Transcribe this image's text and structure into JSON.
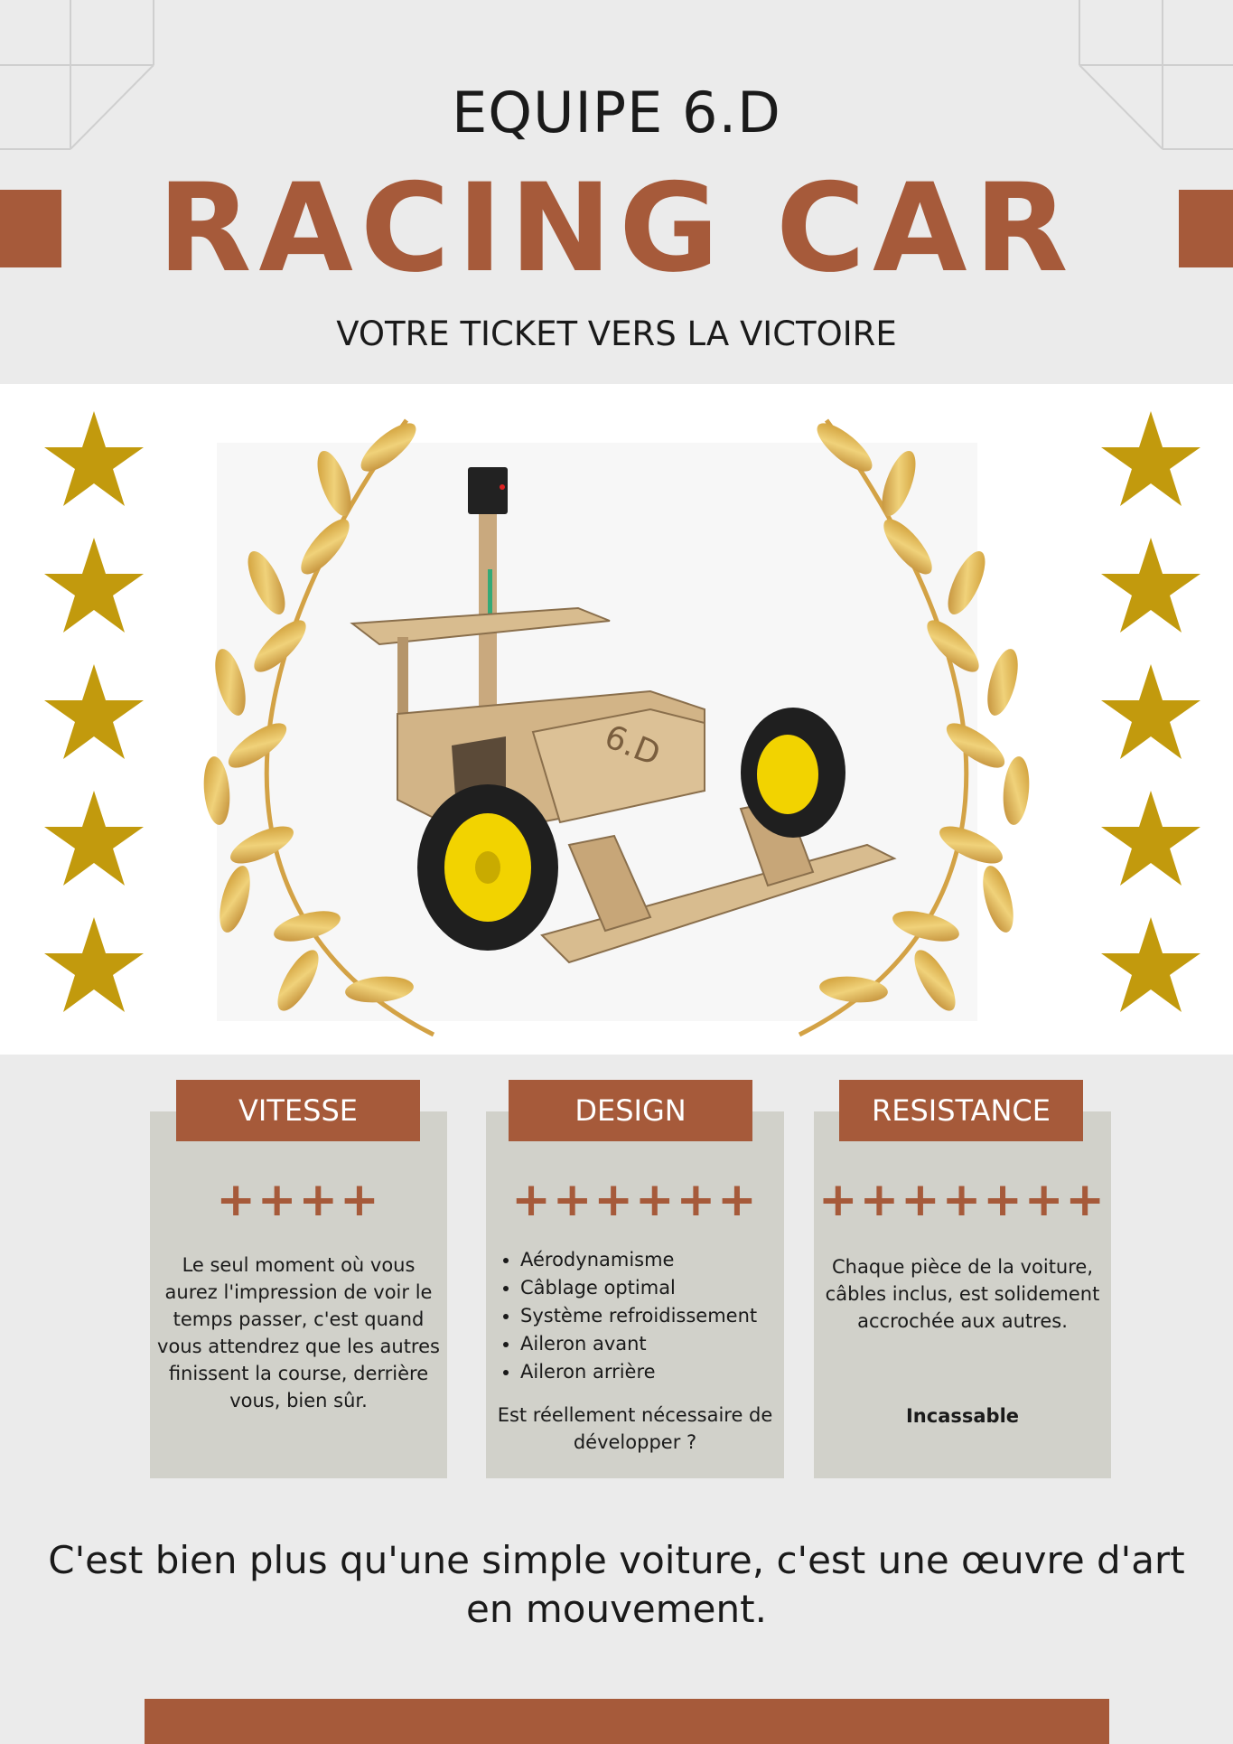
{
  "header": {
    "team": "EQUIPE 6.D",
    "title": "RACING CAR",
    "subtitle": "VOTRE TICKET VERS LA VICTOIRE"
  },
  "colors": {
    "accent": "#a65a3a",
    "star": "#c29a0d",
    "card": "#d1d1ca",
    "background": "#ebebeb"
  },
  "hero": {
    "car_label": "6.D",
    "stars_per_side": 5
  },
  "cards": [
    {
      "title": "VITESSE",
      "rating": "++++",
      "text": "Le seul moment où vous aurez l'impression de voir le temps passer, c'est quand vous attendrez que les autres finissent la course, derrière vous, bien sûr."
    },
    {
      "title": "DESIGN",
      "rating": "++++++",
      "items": [
        "Aérodynamisme",
        "Câblage optimal",
        "Système refroidissement",
        "Aileron avant",
        "Aileron arrière"
      ],
      "text": "Est réellement nécessaire de développer ?"
    },
    {
      "title": "RESISTANCE",
      "rating": "+++++++",
      "text": "Chaque pièce de la voiture, câbles inclus, est solidement accrochée aux autres.",
      "emphasis": "Incassable"
    }
  ],
  "tagline": "C'est bien plus qu'une simple voiture, c'est une œuvre d'art en mouvement."
}
